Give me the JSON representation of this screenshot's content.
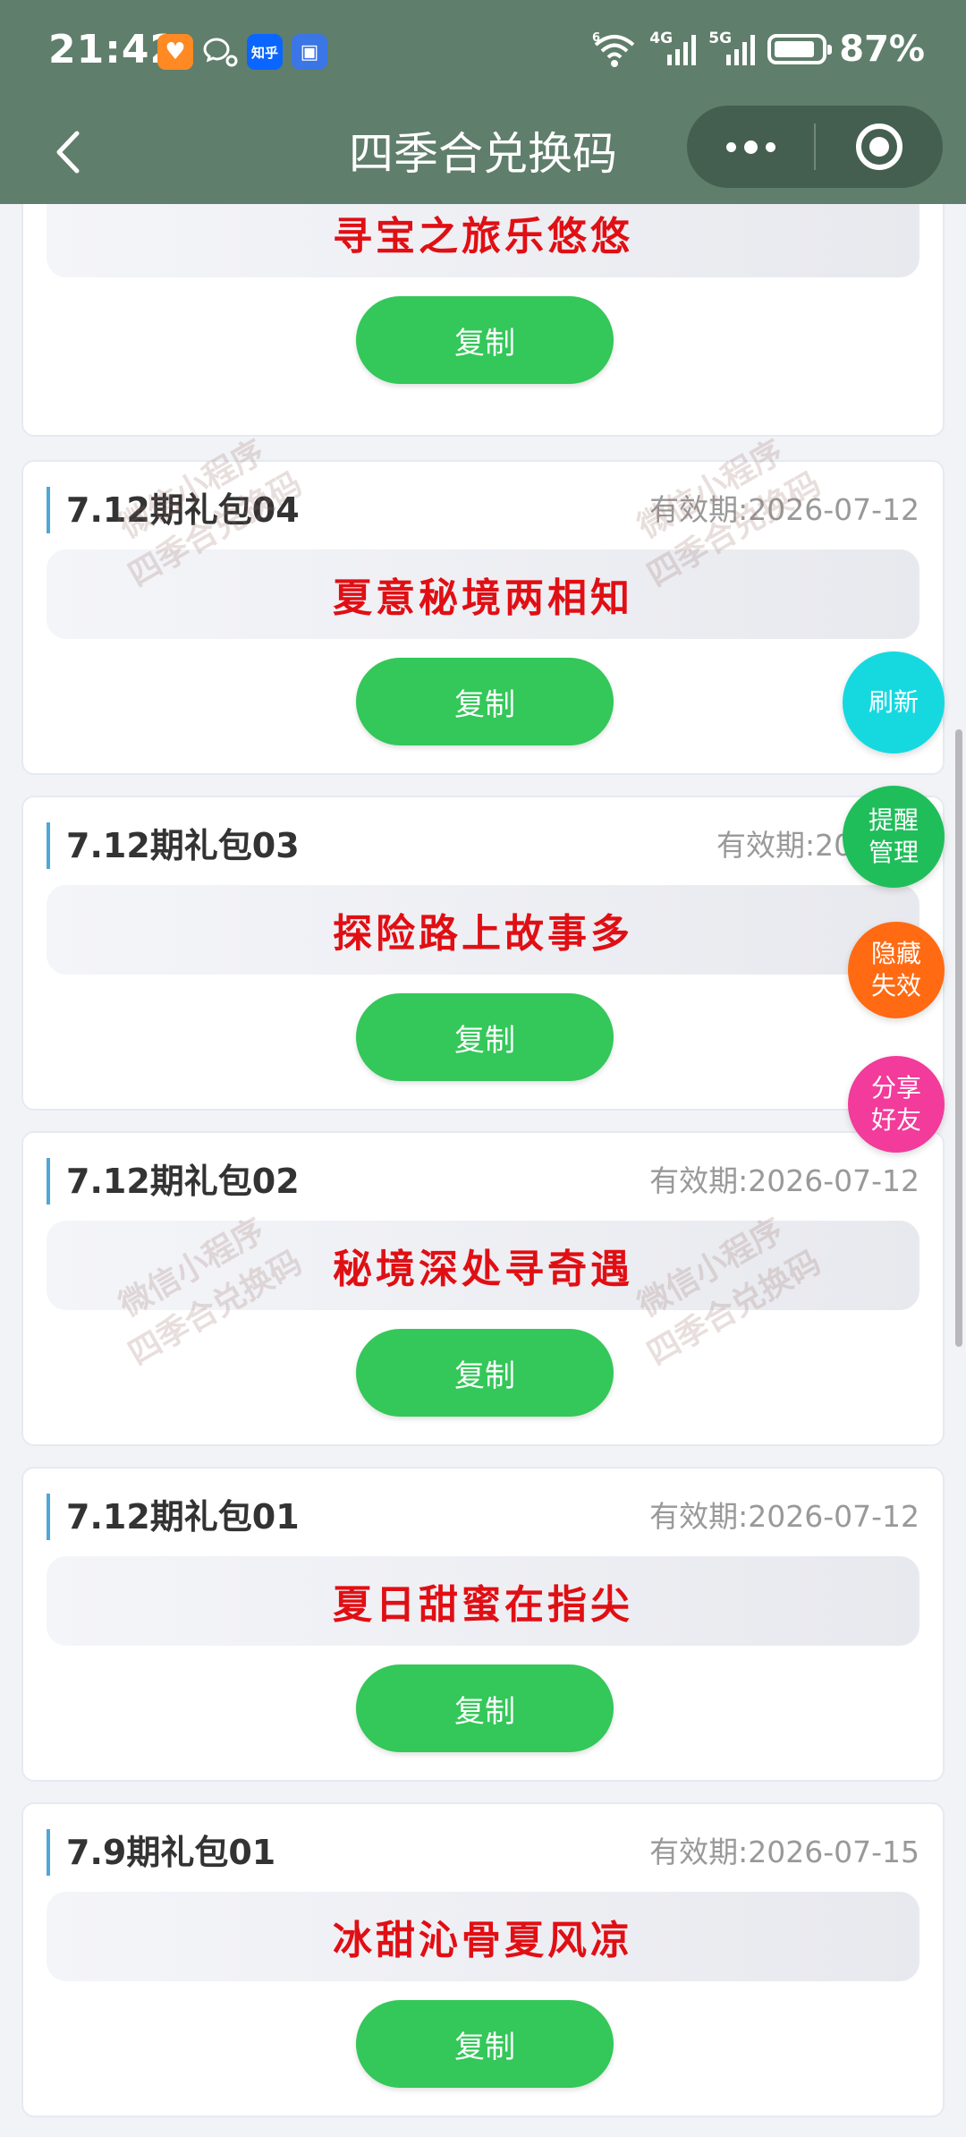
{
  "status_bar": {
    "time": "21:42",
    "zhihu_label": "知乎",
    "net1": "4G",
    "net2": "5G",
    "wifi_sup": "6",
    "battery_pct": "87%",
    "battery_level": 0.87
  },
  "nav": {
    "title": "四季合兑换码"
  },
  "copy_label": "复制",
  "date_prefix": "有效期:",
  "watermark": {
    "line1": "微信小程序",
    "line2": "四季合兑换码"
  },
  "cards": [
    {
      "title": "",
      "date": "",
      "code": "寻宝之旅乐悠悠"
    },
    {
      "title": "7.12期礼包04",
      "date": "2026-07-12",
      "code": "夏意秘境两相知"
    },
    {
      "title": "7.12期礼包03",
      "date": "2026-0",
      "code": "探险路上故事多"
    },
    {
      "title": "7.12期礼包02",
      "date": "2026-07-12",
      "code": "秘境深处寻奇遇"
    },
    {
      "title": "7.12期礼包01",
      "date": "2026-07-12",
      "code": "夏日甜蜜在指尖"
    },
    {
      "title": "7.9期礼包01",
      "date": "2026-07-15",
      "code": "冰甜沁骨夏风凉"
    }
  ],
  "fabs": {
    "refresh": "刷新",
    "reminder": "提醒\n管理",
    "hide_invalid": "隐藏\n失效",
    "share": "分享\n好友"
  },
  "colors": {
    "header_bg": "#5f7e6b",
    "code_text": "#e00f14",
    "copy_button": "#34c759",
    "title_accent": "#4ea7d8",
    "fab_refresh": "#16d9e0",
    "fab_reminder": "#1fbe5a",
    "fab_hide": "#ff6a12",
    "fab_share": "#f23b9a"
  }
}
